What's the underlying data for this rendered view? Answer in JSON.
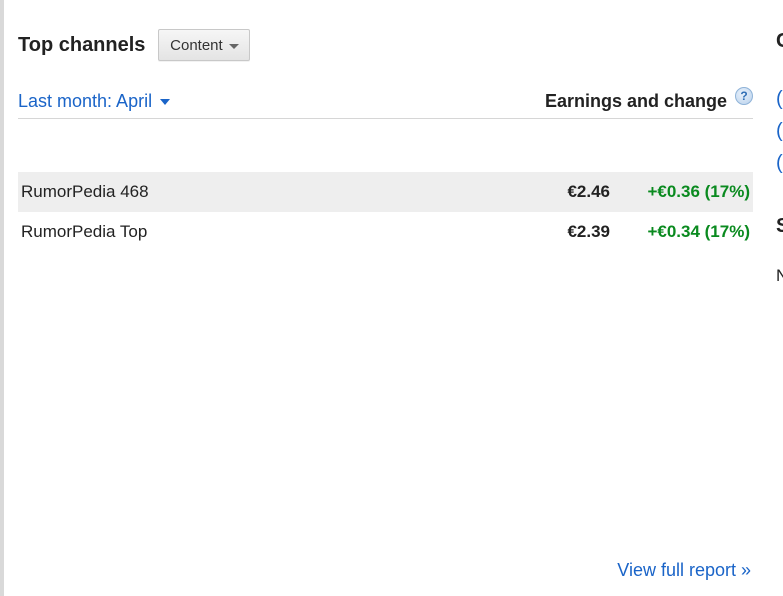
{
  "widget": {
    "title": "Top channels",
    "content_button_label": "Content",
    "range_label": "Last month: April",
    "column_header": "Earnings and change",
    "rows": [
      {
        "name": "RumorPedia 468",
        "earnings": "€2.46",
        "change": "+€0.36 (17%)"
      },
      {
        "name": "RumorPedia Top",
        "earnings": "€2.39",
        "change": "+€0.34 (17%)"
      }
    ],
    "view_full_report": "View full report »"
  },
  "icons": {
    "help": "help-icon",
    "content_caret": "chevron-down-icon",
    "range_caret": "chevron-down-icon"
  },
  "colors": {
    "link": "#1a64c8",
    "positive_change": "#0a8a1f",
    "row_highlight": "#eeeeee"
  },
  "edge_glyphs": [
    "C",
    "(",
    "(",
    "(",
    "S",
    "N"
  ]
}
